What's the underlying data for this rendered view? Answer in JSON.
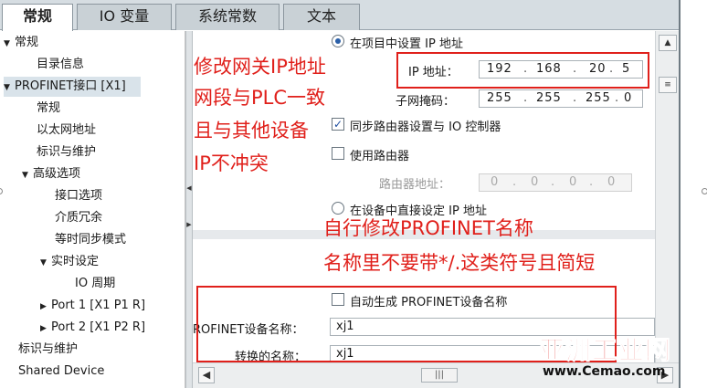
{
  "tabs": [
    {
      "label": "常规",
      "active": true
    },
    {
      "label": "IO 变量",
      "active": false
    },
    {
      "label": "系统常数",
      "active": false
    },
    {
      "label": "文本",
      "active": false
    }
  ],
  "tree": [
    {
      "label": "常规",
      "arrow": "down"
    },
    {
      "label": "目录信息",
      "arrow": ""
    },
    {
      "label": "PROFINET接口 [X1]",
      "arrow": "down",
      "selected": true
    },
    {
      "label": "常规",
      "arrow": ""
    },
    {
      "label": "以太网地址",
      "arrow": ""
    },
    {
      "label": "标识与维护",
      "arrow": ""
    },
    {
      "label": "高级选项",
      "arrow": "down"
    },
    {
      "label": "接口选项",
      "arrow": ""
    },
    {
      "label": "介质冗余",
      "arrow": ""
    },
    {
      "label": "等时同步模式",
      "arrow": ""
    },
    {
      "label": "实时设定",
      "arrow": "down"
    },
    {
      "label": "IO 周期",
      "arrow": ""
    },
    {
      "label": "Port 1 [X1 P1 R]",
      "arrow": "right"
    },
    {
      "label": "Port 2 [X1 P2 R]",
      "arrow": "right"
    },
    {
      "label": "标识与维护",
      "arrow": ""
    },
    {
      "label": "Shared Device",
      "arrow": ""
    }
  ],
  "ip": {
    "set_in_project_label": "在项目中设置 IP 地址",
    "ip_label": "IP 地址：",
    "ip_octets": [
      "192",
      "168",
      "20",
      "5"
    ],
    "subnet_label": "子网掩码：",
    "subnet_octets": [
      "255",
      "255",
      "255",
      "0"
    ],
    "sync_router_label": "同步路由器设置与 IO 控制器",
    "sync_router_checked": true,
    "use_router_label": "使用路由器",
    "use_router_checked": false,
    "router_addr_label": "路由器地址：",
    "router_octets": [
      "0",
      "0",
      "0",
      "0"
    ],
    "set_on_device_label": "在设备中直接设定 IP 地址"
  },
  "profinet": {
    "auto_name_label": "自动生成 PROFINET设备名称",
    "auto_name_checked": false,
    "device_name_label": "ROFINET设备名称：",
    "device_name_value": "xj1",
    "converted_name_label": "转换的名称：",
    "converted_name_value": "xj1"
  },
  "annotations": {
    "note1": [
      "修改网关IP地址",
      "网段与PLC一致",
      "且与其他设备",
      "IP不冲突"
    ],
    "note2": [
      "自行修改PROFINET名称",
      "名称里不要带*/.这类符号且简短"
    ],
    "color": "#e0201b"
  },
  "watermark": {
    "main": "亚洲工业网",
    "url": "www.Cemao.com"
  }
}
